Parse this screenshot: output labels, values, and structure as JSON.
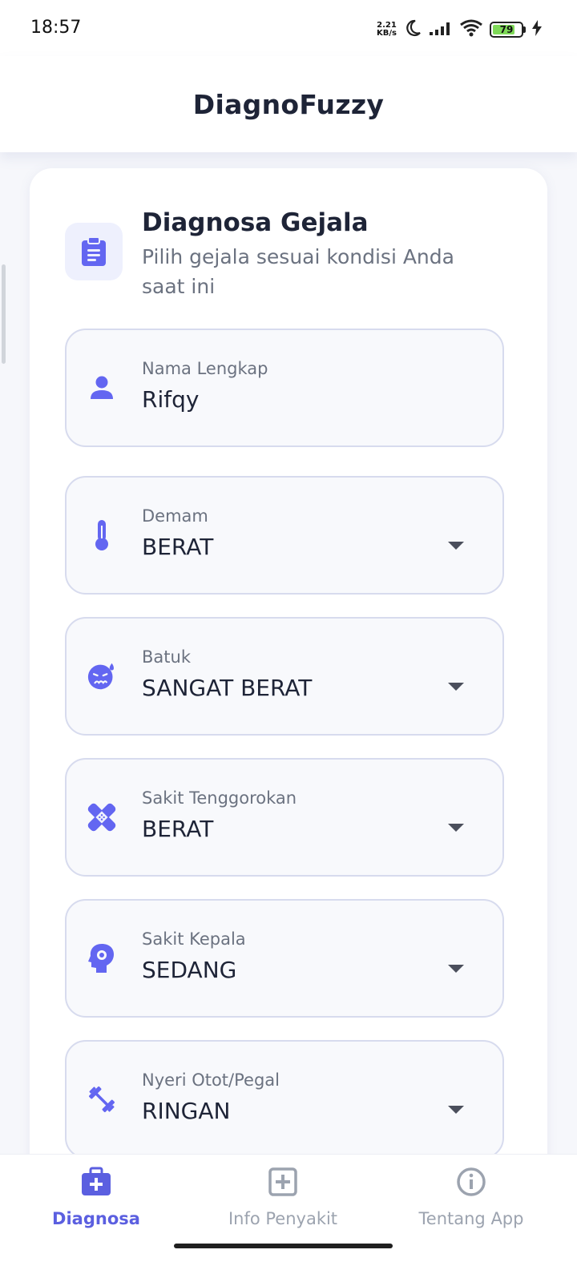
{
  "status_bar": {
    "time": "18:57",
    "net_speed_value": "2.21",
    "net_speed_unit": "KB/s",
    "battery_level": "79",
    "battery_fraction": 0.79,
    "icons": [
      "moon-icon",
      "signal-icon",
      "wifi-icon",
      "battery-icon",
      "charging-bolt-icon"
    ]
  },
  "header": {
    "title": "DiagnoFuzzy"
  },
  "card": {
    "icon": "clipboard-icon",
    "title": "Diagnosa Gejala",
    "subtitle": "Pilih gejala sesuai kondisi Anda saat ini"
  },
  "fields": {
    "name": {
      "label": "Nama Lengkap",
      "value": "Rifqy",
      "icon": "person-icon"
    },
    "fever": {
      "label": "Demam",
      "value": "BERAT",
      "icon": "thermometer-icon"
    },
    "cough": {
      "label": "Batuk",
      "value": "SANGAT BERAT",
      "icon": "sick-face-icon"
    },
    "throat": {
      "label": "Sakit Tenggorokan",
      "value": "BERAT",
      "icon": "bandage-icon"
    },
    "headache": {
      "label": "Sakit Kepala",
      "value": "SEDANG",
      "icon": "head-gear-icon"
    },
    "muscle": {
      "label": "Nyeri Otot/Pegal",
      "value": "RINGAN",
      "icon": "dumbbell-icon"
    }
  },
  "bottom_nav": {
    "items": [
      {
        "label": "Diagnosa",
        "icon": "medical-bag-icon",
        "active": true
      },
      {
        "label": "Info Penyakit",
        "icon": "plus-box-icon",
        "active": false
      },
      {
        "label": "Tentang App",
        "icon": "info-circle-icon",
        "active": false
      }
    ]
  },
  "colors": {
    "accent": "#5b5fe0",
    "inactive": "#9ca3af",
    "title": "#1e2437",
    "field_border": "#d7dbee",
    "background": "#f6f7fb"
  }
}
